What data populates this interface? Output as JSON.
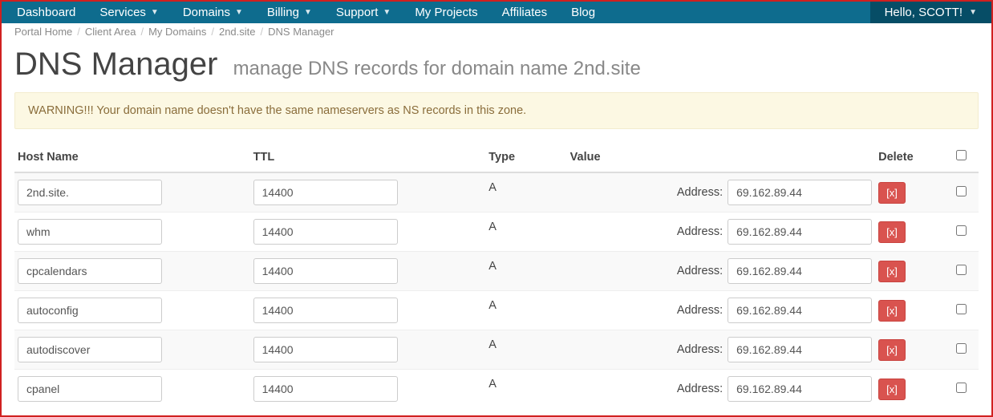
{
  "nav": {
    "left": [
      {
        "label": "Dashboard",
        "dropdown": false
      },
      {
        "label": "Services",
        "dropdown": true
      },
      {
        "label": "Domains",
        "dropdown": true
      },
      {
        "label": "Billing",
        "dropdown": true
      },
      {
        "label": "Support",
        "dropdown": true
      },
      {
        "label": "My Projects",
        "dropdown": false
      },
      {
        "label": "Affiliates",
        "dropdown": false
      },
      {
        "label": "Blog",
        "dropdown": false
      }
    ],
    "right": {
      "label": "Hello, SCOTT!",
      "dropdown": true
    }
  },
  "breadcrumb": [
    "Portal Home",
    "Client Area",
    "My Domains",
    "2nd.site",
    "DNS Manager"
  ],
  "page": {
    "title": "DNS Manager",
    "subtitle": "manage DNS records for domain name 2nd.site"
  },
  "alert": "WARNING!!! Your domain name doesn't have the same nameservers as NS records in this zone.",
  "columns": {
    "host": "Host Name",
    "ttl": "TTL",
    "type": "Type",
    "value": "Value",
    "delete": "Delete"
  },
  "value_label": "Address:",
  "delete_button_label": "[x]",
  "records": [
    {
      "host": "2nd.site.",
      "ttl": "14400",
      "type": "A",
      "address": "69.162.89.44"
    },
    {
      "host": "whm",
      "ttl": "14400",
      "type": "A",
      "address": "69.162.89.44"
    },
    {
      "host": "cpcalendars",
      "ttl": "14400",
      "type": "A",
      "address": "69.162.89.44"
    },
    {
      "host": "autoconfig",
      "ttl": "14400",
      "type": "A",
      "address": "69.162.89.44"
    },
    {
      "host": "autodiscover",
      "ttl": "14400",
      "type": "A",
      "address": "69.162.89.44"
    },
    {
      "host": "cpanel",
      "ttl": "14400",
      "type": "A",
      "address": "69.162.89.44"
    }
  ]
}
